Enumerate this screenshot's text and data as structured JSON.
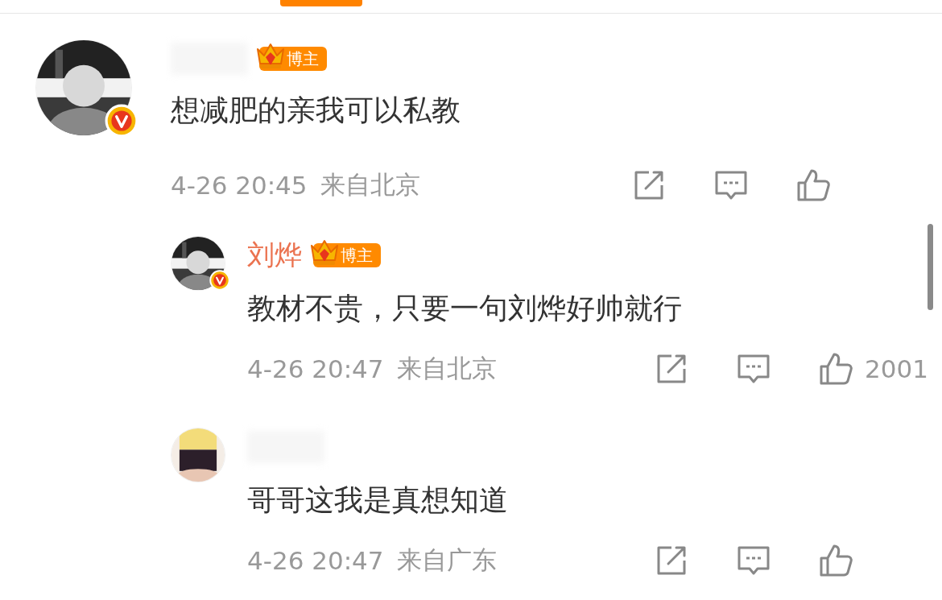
{
  "tabs": [
    {
      "selected": true
    }
  ],
  "comments": [
    {
      "verified": true,
      "name_hidden": true,
      "badge": "博主",
      "text": "想减肥的亲我可以私教",
      "time": "4-26 20:45",
      "location": "来自北京",
      "replies": [
        {
          "verified": true,
          "name": "刘烨",
          "badge": "博主",
          "text": "教材不贵，只要一句刘烨好帅就行",
          "time": "4-26 20:47",
          "location": "来自北京",
          "likes": "2001"
        },
        {
          "verified": false,
          "name_hidden": true,
          "text": "哥哥这我是真想知道",
          "time": "4-26 20:47",
          "location": "来自广东"
        }
      ]
    }
  ]
}
